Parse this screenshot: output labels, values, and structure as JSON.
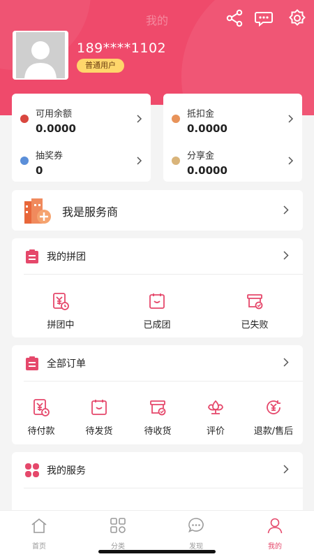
{
  "header": {
    "title": "我的",
    "phone": "189****1102",
    "badge": "普通用户",
    "icons": [
      "share-icon",
      "message-icon",
      "settings-icon"
    ],
    "accent": "#ef4a6b"
  },
  "wallet": {
    "left": [
      {
        "label": "可用余额",
        "value": "0.0000",
        "dot": "#d9473f"
      },
      {
        "label": "抽奖券",
        "value": "0",
        "dot": "#5b8fd9"
      }
    ],
    "right": [
      {
        "label": "抵扣金",
        "value": "0.0000",
        "dot": "#e8935a"
      },
      {
        "label": "分享金",
        "value": "0.0000",
        "dot": "#d9b47a"
      }
    ]
  },
  "provider": {
    "label": "我是服务商"
  },
  "group": {
    "title": "我的拼团",
    "items": [
      {
        "label": "拼团中",
        "icon": "yen-clock-icon"
      },
      {
        "label": "已成团",
        "icon": "bag-smile-icon"
      },
      {
        "label": "已失败",
        "icon": "box-check-icon"
      }
    ]
  },
  "orders": {
    "title": "全部订单",
    "items": [
      {
        "label": "待付款",
        "icon": "yen-clock-icon"
      },
      {
        "label": "待发货",
        "icon": "bag-smile-icon"
      },
      {
        "label": "待收货",
        "icon": "box-check-icon"
      },
      {
        "label": "评价",
        "icon": "flower-icon"
      },
      {
        "label": "退款/售后",
        "icon": "refund-icon"
      }
    ]
  },
  "services": {
    "title": "我的服务"
  },
  "nav": [
    {
      "label": "首页",
      "icon": "home-icon",
      "active": false
    },
    {
      "label": "分类",
      "icon": "category-icon",
      "active": false
    },
    {
      "label": "发现",
      "icon": "discover-icon",
      "active": false
    },
    {
      "label": "我的",
      "icon": "user-icon",
      "active": true
    }
  ]
}
